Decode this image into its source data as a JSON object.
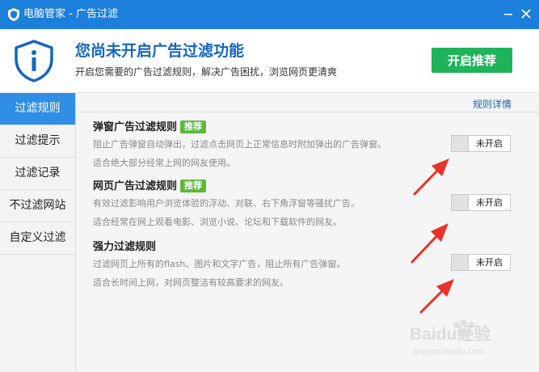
{
  "window": {
    "title": "电脑管家 - 广告过滤"
  },
  "header": {
    "title": "您尚未开启广告过滤功能",
    "subtitle": "开启您需要的广告过滤规则，解决广告困扰，浏览网页更清爽",
    "enable_button": "开启推荐"
  },
  "sidebar": {
    "items": [
      {
        "label": "过滤规则",
        "active": true
      },
      {
        "label": "过滤提示",
        "active": false
      },
      {
        "label": "过滤记录",
        "active": false
      },
      {
        "label": "不过滤网站",
        "active": false
      },
      {
        "label": "自定义过滤",
        "active": false
      }
    ]
  },
  "main": {
    "detail_link": "规则详情",
    "rules": [
      {
        "title": "弹窗广告过滤规则",
        "badge": "推荐",
        "desc": "阻止广告弹窗自动弹出，过滤点击网页上正常信息时附加弹出的广告弹窗。",
        "fit": "适合绝大部分经常上网的网友使用。",
        "toggle": "未开启"
      },
      {
        "title": "网页广告过滤规则",
        "badge": "推荐",
        "desc": "有效过滤影响用户浏览体验的浮动、对联、右下角浮窗等骚扰广告。",
        "fit": "适合经常在网上观看电影、浏览小说、论坛和下载软件的网友。",
        "toggle": "未开启"
      },
      {
        "title": "强力过滤规则",
        "desc": "过滤网页上所有的flash、图片和文字广告，阻止所有广告弹窗。",
        "fit": "适合长时间上网，对网页整洁有较高要求的网友。",
        "toggle": "未开启"
      }
    ]
  },
  "watermark": {
    "text": "Baidu经验",
    "url_text": "jingyan.baidu.com"
  },
  "colors": {
    "titlebar": "#1c7fdb",
    "accent_blue": "#1565c0",
    "enable_green": "#1fb35a",
    "badge_green": "#5eb83a",
    "sidebar_active": "#2f8ee5",
    "arrow_red": "#e8322a"
  },
  "icons": {
    "titlebar_logo": "shield-logo-icon",
    "header": "shield-info-icon",
    "minimize": "minimize-icon",
    "close": "close-icon",
    "annotation": "red-arrow-icon"
  }
}
